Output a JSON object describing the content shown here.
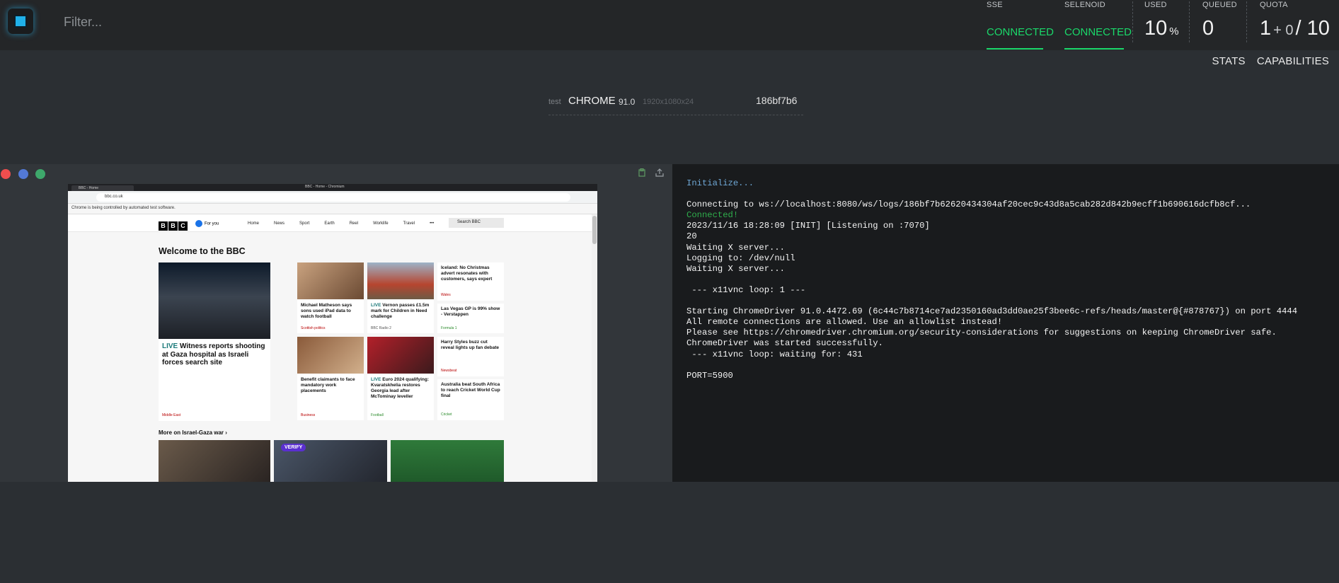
{
  "filter": {
    "placeholder": "Filter..."
  },
  "status": {
    "sse": {
      "label": "SSE",
      "value": "CONNECTED"
    },
    "selenoid": {
      "label": "SELENOID",
      "value": "CONNECTED"
    },
    "used": {
      "label": "USED",
      "value": "10",
      "unit": "%"
    },
    "queued": {
      "label": "QUEUED",
      "value": "0"
    },
    "quota": {
      "label": "QUOTA",
      "current": "1",
      "plus": "+ 0",
      "total": "/ 10"
    }
  },
  "nav": {
    "stats": "STATS",
    "capabilities": "CAPABILITIES"
  },
  "session": {
    "name_label": "test",
    "browser": "CHROME",
    "version": "91.0",
    "resolution": "1920x1080x24",
    "id": "186bf7b6"
  },
  "colors": {
    "accent": "#1ad86a",
    "logo": "#20b1ea",
    "background": "#2b2f33",
    "log_background": "#191b1d"
  },
  "icons": {
    "vnc_tools": [
      "clipboard-icon",
      "upload-icon"
    ]
  },
  "logs": [
    "Initialize...",
    "",
    "Connecting to ws://localhost:8080/ws/logs/186bf7b62620434304af20cec9c43d8a5cab282d842b9ecff1b690616dcfb8cf...",
    "Connected!",
    "2023/11/16 18:28:09 [INIT] [Listening on :7070]",
    "20",
    "Waiting X server...",
    "Logging to: /dev/null",
    "Waiting X server...",
    "",
    " --- x11vnc loop: 1 ---",
    "",
    "Starting ChromeDriver 91.0.4472.69 (6c44c7b8714ce7ad2350160ad3dd0ae25f3bee6c-refs/heads/master@{#878767}) on port 4444",
    "All remote connections are allowed. Use an allowlist instead!",
    "Please see https://chromedriver.chromium.org/security-considerations for suggestions on keeping ChromeDriver safe.",
    "ChromeDriver was started successfully.",
    " --- x11vnc loop: waiting for: 431",
    "",
    "PORT=5900"
  ],
  "browser_screen": {
    "tab_title": "BBC - Home",
    "window_title": "BBC - Home - Chromium",
    "url": "bbc.co.uk",
    "info_bar": "Chrome is being controlled by automated test software.",
    "foryou": "For you",
    "links": [
      "Home",
      "News",
      "Sport",
      "Earth",
      "Reel",
      "Worklife",
      "Travel",
      "•••"
    ],
    "search": "Search BBC",
    "welcome": "Welcome to the BBC",
    "main_story": {
      "live": "LIVE",
      "title": "Witness reports shooting at Gaza hospital as Israeli forces search site",
      "tag": "Middle East"
    },
    "stories": [
      {
        "title": "Michael Matheson says sons used iPad data to watch football",
        "tag": "Scottish politics"
      },
      {
        "live": "LIVE",
        "title": "Vernon passes £1.5m mark for Children in Need challenge",
        "tag": "BBC Radio 2"
      },
      {
        "title": "Iceland: No Christmas advert resonates with customers, says expert",
        "tag": "Wales"
      },
      {
        "title": "Las Vegas GP is 99% show - Verstappen",
        "tag": "Formula 1"
      },
      {
        "title": "Benefit claimants to face mandatory work placements",
        "tag": "Business"
      },
      {
        "live": "LIVE",
        "title": "Euro 2024 qualifying: Kvaratskhelia restores Georgia lead after McTominay leveller",
        "tag": "Football"
      },
      {
        "title": "Harry Styles buzz cut reveal lights up fan debate",
        "tag": "Newsbeat"
      },
      {
        "title": "Australia beat South Africa to reach Cricket World Cup final",
        "tag": "Cricket"
      }
    ],
    "more": "More on Israel-Gaza war ›",
    "verify": "VERIFY",
    "logo_letters": [
      "B",
      "B",
      "C"
    ]
  }
}
